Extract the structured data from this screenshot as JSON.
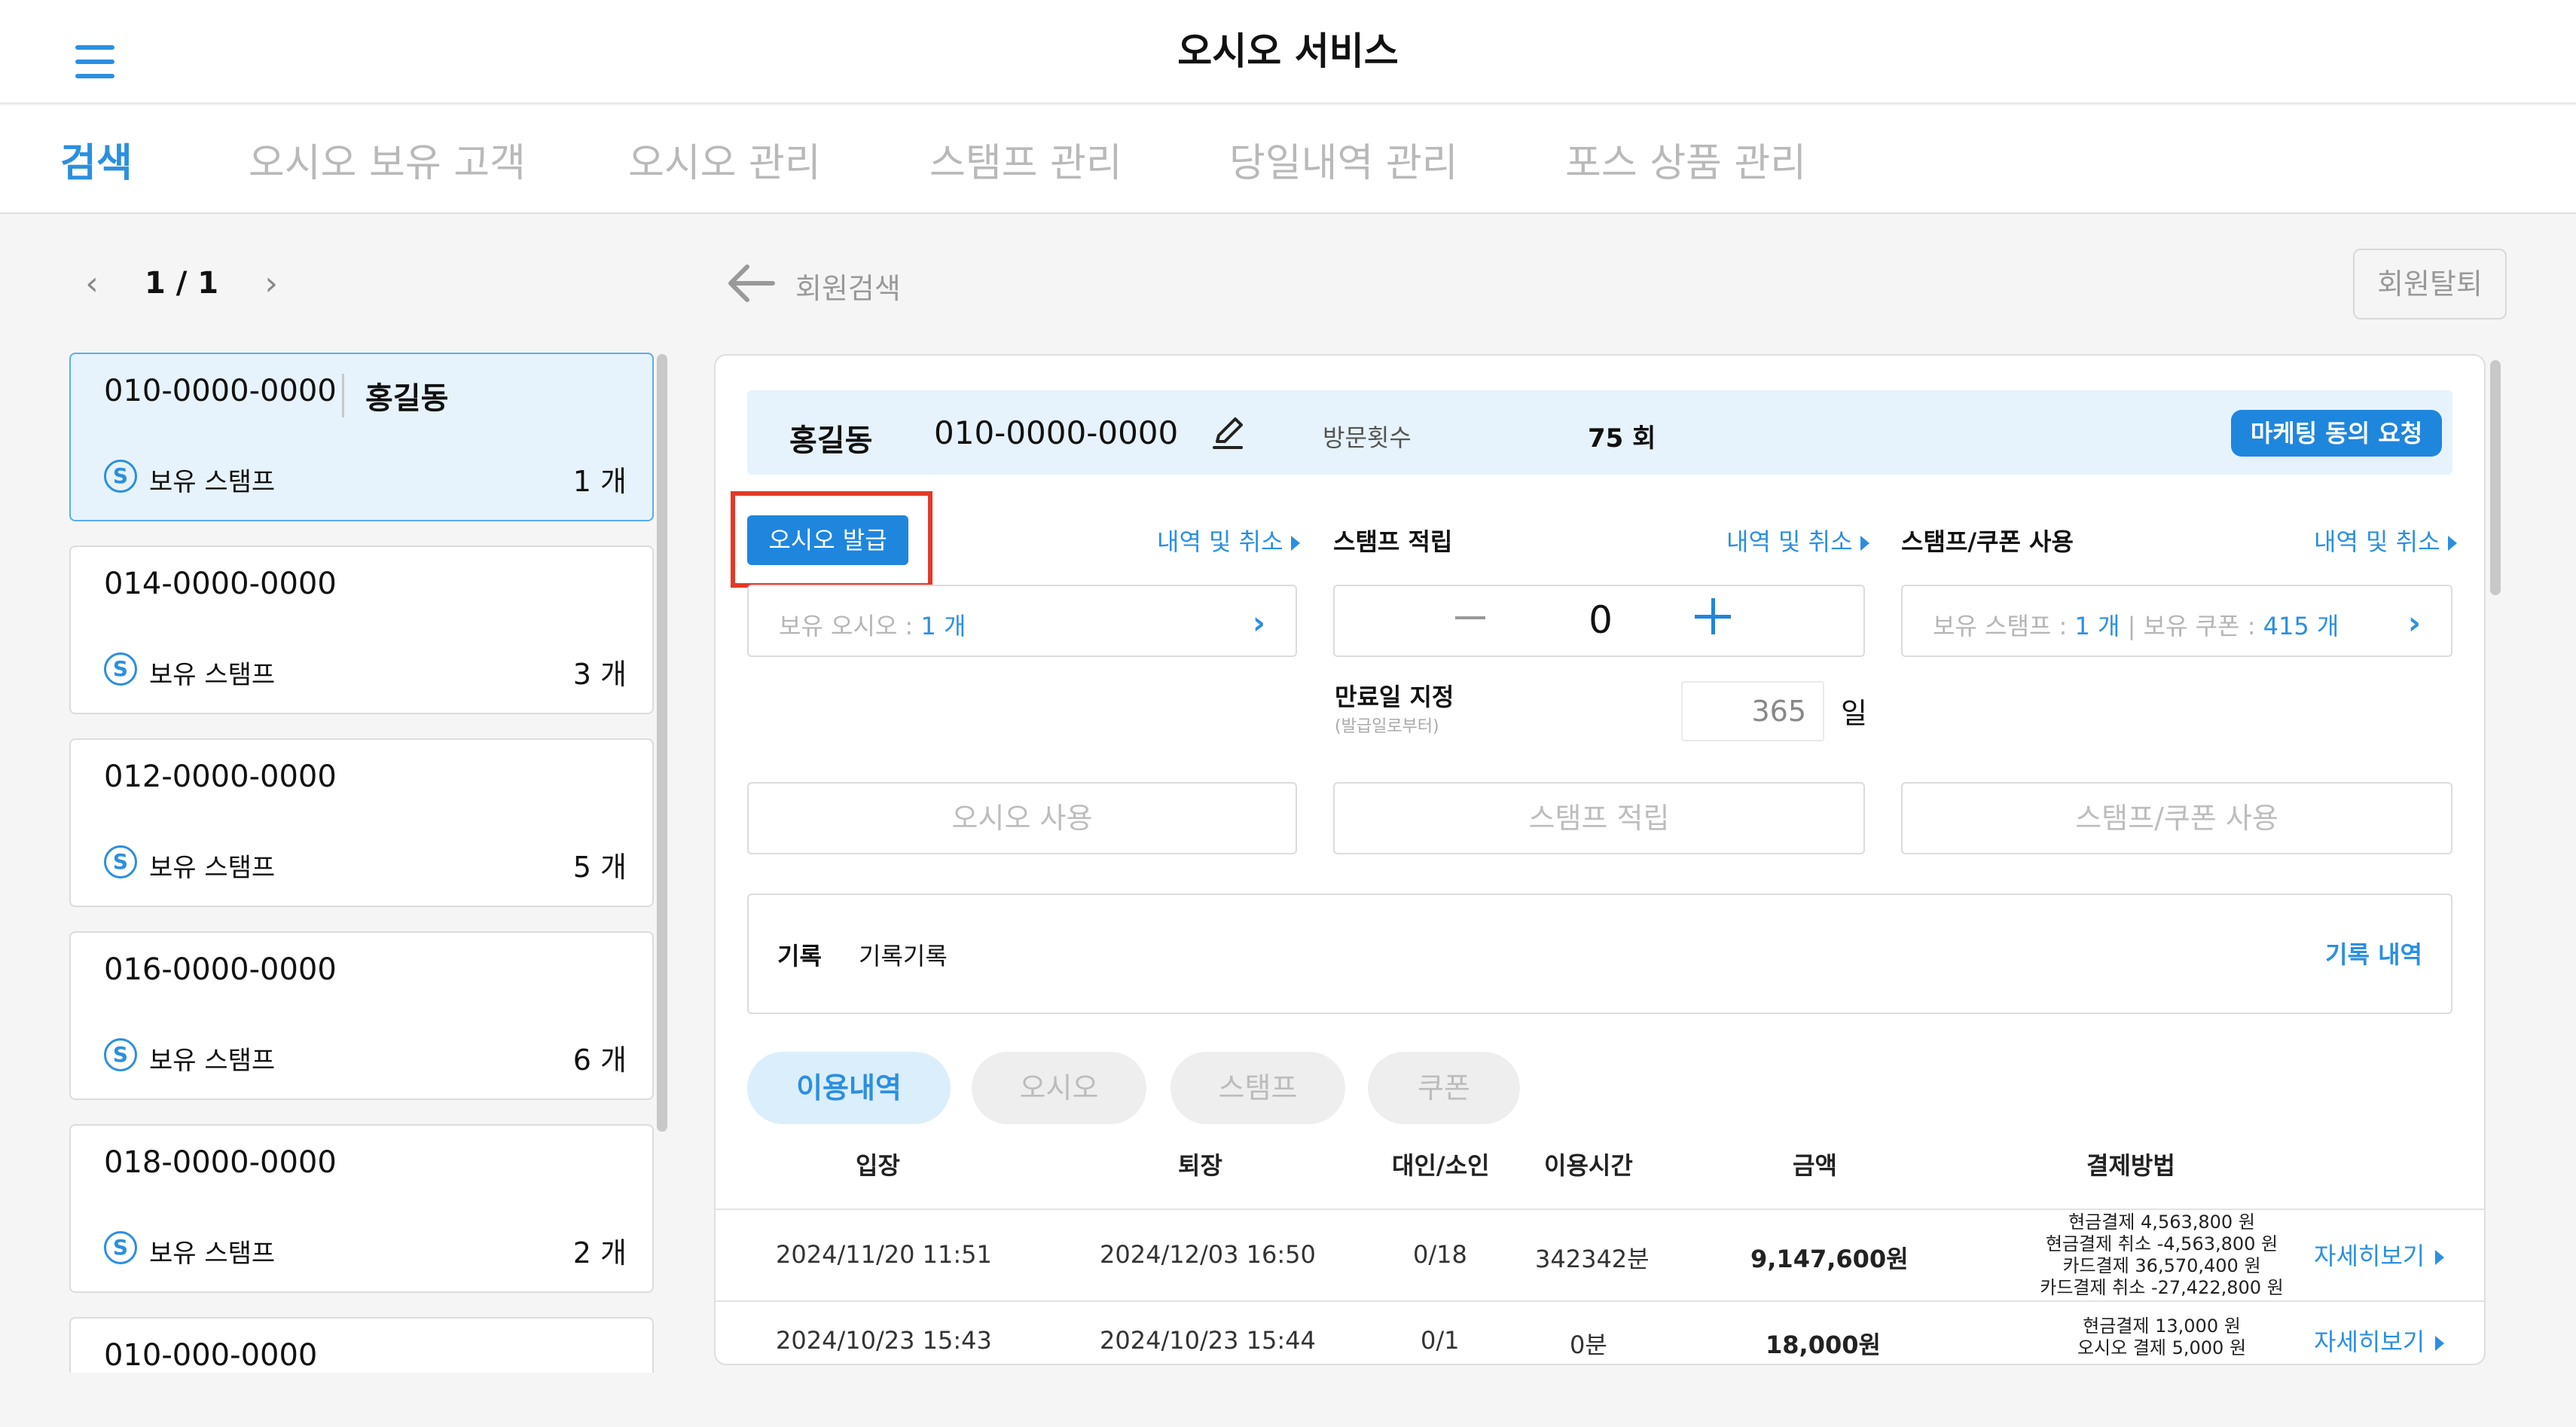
{
  "app": {
    "title": "오시오 서비스"
  },
  "tabs": [
    {
      "label": "검색",
      "active": true
    },
    {
      "label": "오시오 보유 고객",
      "active": false
    },
    {
      "label": "오시오 관리",
      "active": false
    },
    {
      "label": "스탬프 관리",
      "active": false
    },
    {
      "label": "당일내역 관리",
      "active": false
    },
    {
      "label": "포스 상품 관리",
      "active": false
    }
  ],
  "pager": {
    "text": "1 / 1"
  },
  "back": {
    "label": "회원검색"
  },
  "withdraw": {
    "label": "회원탈퇴"
  },
  "members": [
    {
      "phone": "010-0000-0000",
      "name": "홍길동",
      "stamp_label": "보유 스탬프",
      "stamp_count": "1 개",
      "selected": true
    },
    {
      "phone": "014-0000-0000",
      "name": "",
      "stamp_label": "보유 스탬프",
      "stamp_count": "3 개",
      "selected": false
    },
    {
      "phone": "012-0000-0000",
      "name": "",
      "stamp_label": "보유 스탬프",
      "stamp_count": "5 개",
      "selected": false
    },
    {
      "phone": "016-0000-0000",
      "name": "",
      "stamp_label": "보유 스탬프",
      "stamp_count": "6 개",
      "selected": false
    },
    {
      "phone": "018-0000-0000",
      "name": "",
      "stamp_label": "보유 스탬프",
      "stamp_count": "2 개",
      "selected": false
    },
    {
      "phone": "010-000-0000",
      "name": "",
      "stamp_label": "",
      "stamp_count": "",
      "selected": false
    }
  ],
  "stamp_icon_glyph": "S",
  "customer": {
    "name": "홍길동",
    "phone": "010-0000-0000",
    "visits_label": "방문횟수",
    "visits_value": "75 회",
    "marketing_button": "마케팅 동의 요청"
  },
  "osio": {
    "issue_button": "오시오 발급",
    "history_link": "내역 및 취소",
    "owned_label": "보유 오시오 : ",
    "owned_value": "1 개",
    "use_button": "오시오 사용"
  },
  "stamp_earn": {
    "title": "스탬프 적립",
    "history_link": "내역 및 취소",
    "value": "0",
    "expire_label": "만료일 지정",
    "expire_sub": "(발급일로부터)",
    "expire_days": "365",
    "expire_unit": "일",
    "earn_button": "스탬프 적립"
  },
  "stamp_use": {
    "title": "스탬프/쿠폰 사용",
    "history_link": "내역 및 취소",
    "owned_stamp_label": "보유 스탬프 : ",
    "owned_stamp_value": "1 개",
    "separator": "|",
    "owned_coupon_label": "보유 쿠폰 : ",
    "owned_coupon_value": "415 개",
    "use_button": "스탬프/쿠폰 사용"
  },
  "memo": {
    "label": "기록",
    "value": "기록기록",
    "link": "기록 내역"
  },
  "filters": [
    {
      "label": "이용내역",
      "active": true
    },
    {
      "label": "오시오",
      "active": false
    },
    {
      "label": "스탬프",
      "active": false
    },
    {
      "label": "쿠폰",
      "active": false
    }
  ],
  "table": {
    "headers": [
      "입장",
      "퇴장",
      "대인/소인",
      "이용시간",
      "금액",
      "결제방법"
    ],
    "rows": [
      {
        "entry": "2024/11/20 11:51",
        "exit": "2024/12/03 16:50",
        "people": "0/18",
        "duration": "342342분",
        "amount": "9,147,600원",
        "payments": [
          "현금결제 4,563,800 원",
          "현금결제 취소 -4,563,800 원",
          "카드결제 36,570,400 원",
          "카드결제 취소 -27,422,800 원"
        ],
        "detail": "자세히보기"
      },
      {
        "entry": "2024/10/23 15:43",
        "exit": "2024/10/23 15:44",
        "people": "0/1",
        "duration": "0분",
        "amount": "18,000원",
        "payments": [
          "현금결제 13,000 원",
          "오시오 결제 5,000 원"
        ],
        "detail": "자세히보기"
      }
    ]
  },
  "colors": {
    "accent": "#2b8fe0",
    "button_blue": "#1f86dd",
    "highlight_red": "#e23a27",
    "selected_bg": "#e6f3fc"
  },
  "icons": [
    "hamburger-menu-icon",
    "chevron-left-icon",
    "chevron-right-icon",
    "back-arrow-icon",
    "pencil-edit-icon",
    "stamp-s-icon",
    "minus-icon",
    "plus-icon",
    "triangle-right-icon"
  ]
}
